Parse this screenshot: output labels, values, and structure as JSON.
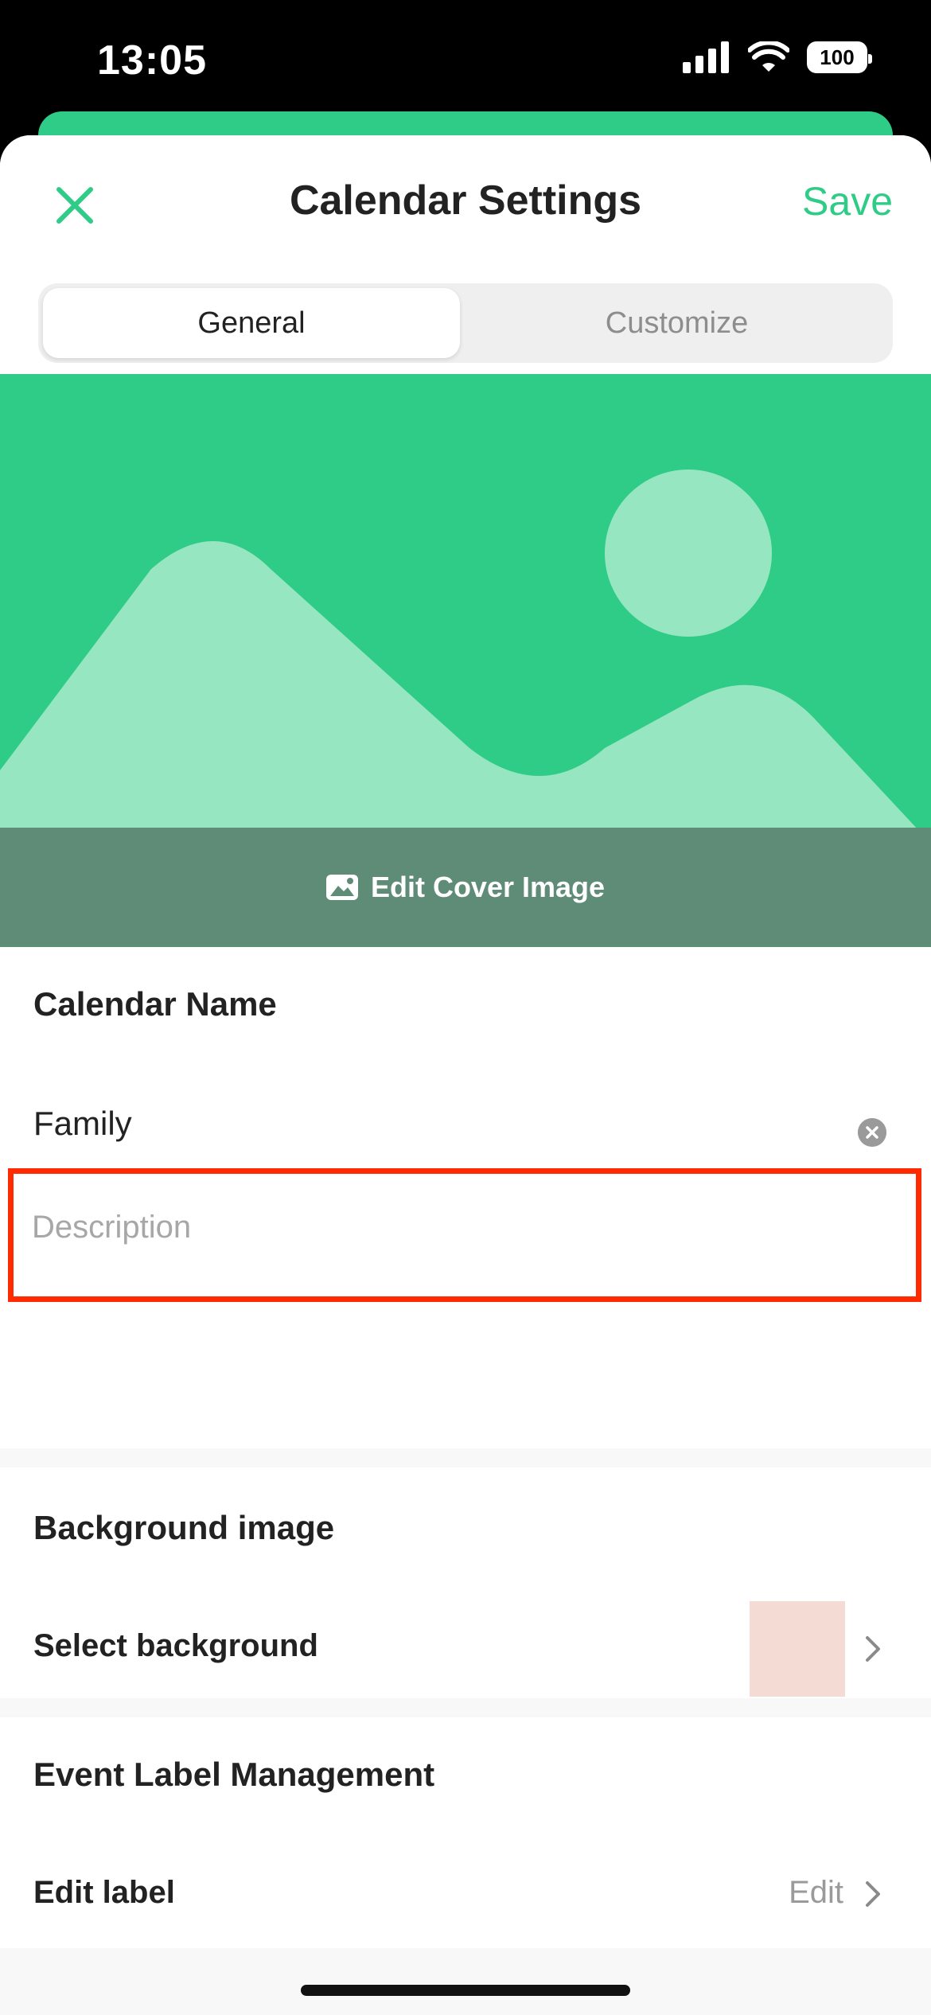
{
  "status_bar": {
    "time": "13:05",
    "battery": "100"
  },
  "header": {
    "title": "Calendar Settings",
    "save_label": "Save"
  },
  "tabs": {
    "general": "General",
    "customize": "Customize"
  },
  "cover": {
    "edit_label": "Edit Cover Image"
  },
  "calendar_name": {
    "section_title": "Calendar Name",
    "name_value": "Family",
    "description_placeholder": "Description"
  },
  "background_image": {
    "section_title": "Background image",
    "select_label": "Select background",
    "swatch_color": "#f4dcd5"
  },
  "event_label": {
    "section_title": "Event Label Management",
    "edit_label": "Edit label",
    "edit_value": "Edit"
  },
  "colors": {
    "accent": "#2ecc86",
    "highlight": "#ff2a00"
  }
}
